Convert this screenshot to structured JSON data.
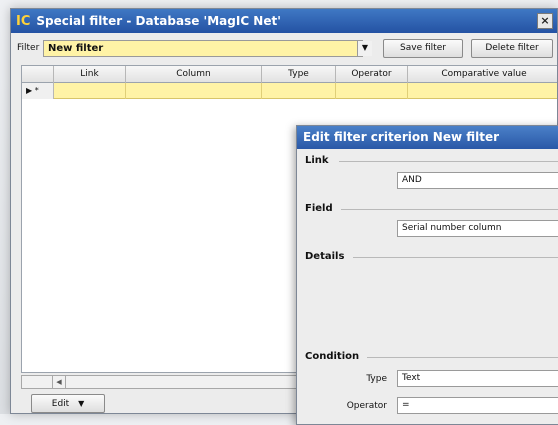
{
  "window": {
    "logo": "IC",
    "title": "Special filter - Database 'MagIC Net'",
    "close_glyph": "×"
  },
  "filter": {
    "label": "Filter",
    "value": "New filter",
    "dropdown_glyph": "▼",
    "save_label": "Save filter",
    "delete_label": "Delete filter"
  },
  "grid": {
    "columns": [
      "Link",
      "Column",
      "Type",
      "Operator",
      "Comparative value"
    ],
    "row_indicator": "▶ *"
  },
  "scroll": {
    "left_glyph": "◀"
  },
  "edit_button": {
    "label": "Edit",
    "glyph": "▼"
  },
  "dialog": {
    "title": "Edit filter criterion New filter",
    "sections": {
      "link": "Link",
      "field": "Field",
      "details": "Details",
      "condition": "Condition"
    },
    "link_value": "AND",
    "field_value": "Serial number column",
    "type_label": "Type",
    "type_value": "Text",
    "operator_label": "Operator",
    "operator_value": "="
  },
  "colors": {
    "titlebar": "#2f63b4",
    "logo": "#ffd23a",
    "highlight_row": "#fff3a6"
  },
  "icons": [
    "close-icon",
    "dropdown-arrow-icon",
    "row-pointer-icon",
    "scroll-left-icon",
    "menu-arrow-icon"
  ]
}
